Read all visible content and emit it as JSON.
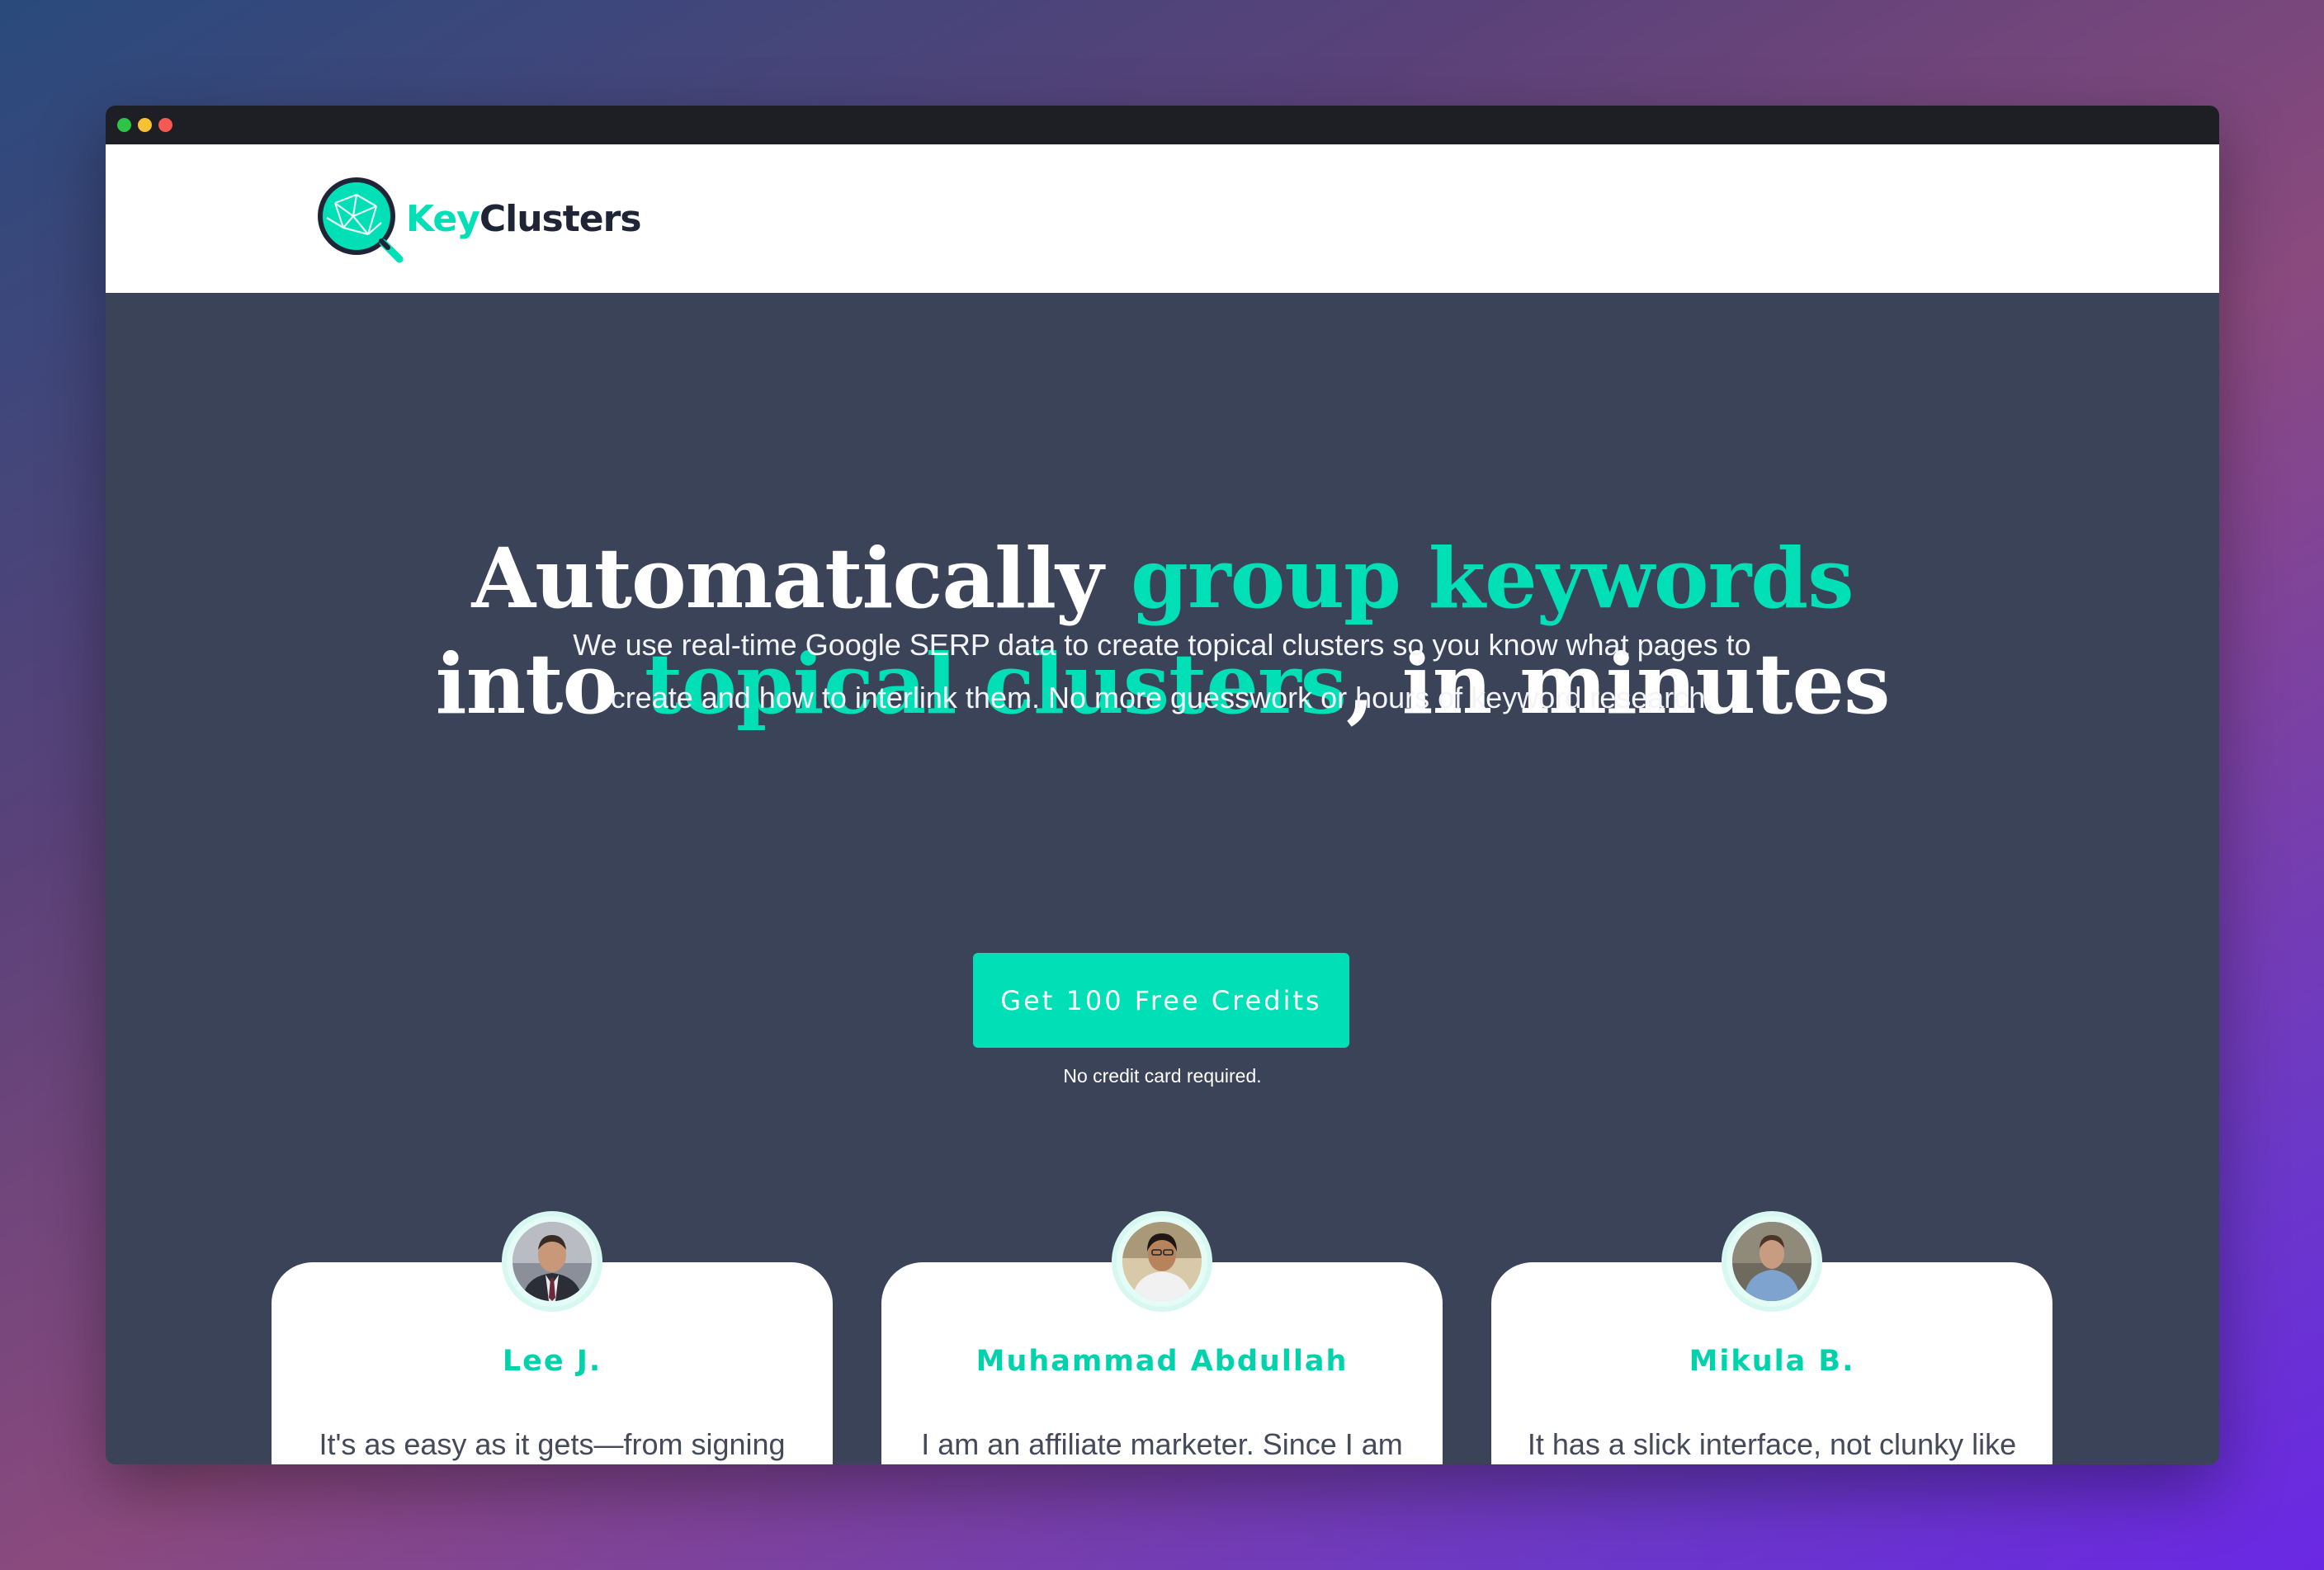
{
  "brand": {
    "name_part1": "Key",
    "name_part2": "Clusters",
    "accent_color": "#00dfb5",
    "dark_color": "#1f2437",
    "logo_icon": "magnifier-network-icon"
  },
  "hero": {
    "headline_1": "Automatically ",
    "headline_2": "group keywords",
    "headline_3": "into ",
    "headline_4": "topical clusters",
    "headline_5": ", in minutes",
    "subtext": "We use real-time Google SERP data to create topical clusters so you know what pages to create and how to interlink them. No more guesswork or hours of keyword research.",
    "cta_label": "Get 100 Free Credits",
    "cta_note": "No credit card required.",
    "background_color": "#3b4358"
  },
  "testimonials": [
    {
      "name": "Lee J.",
      "quote": "It's as easy as it gets—from signing up to uploading a list of keywords and receiving a file with the"
    },
    {
      "name": "Muhammad Abdullah",
      "quote": "I am an affiliate marketer. Since I am using Ahrefs & Semrush, its hard for me to cluster keywords."
    },
    {
      "name": "Mikula B.",
      "quote": "It has a slick interface, not clunky like many others, it can use more features but overall good."
    }
  ]
}
